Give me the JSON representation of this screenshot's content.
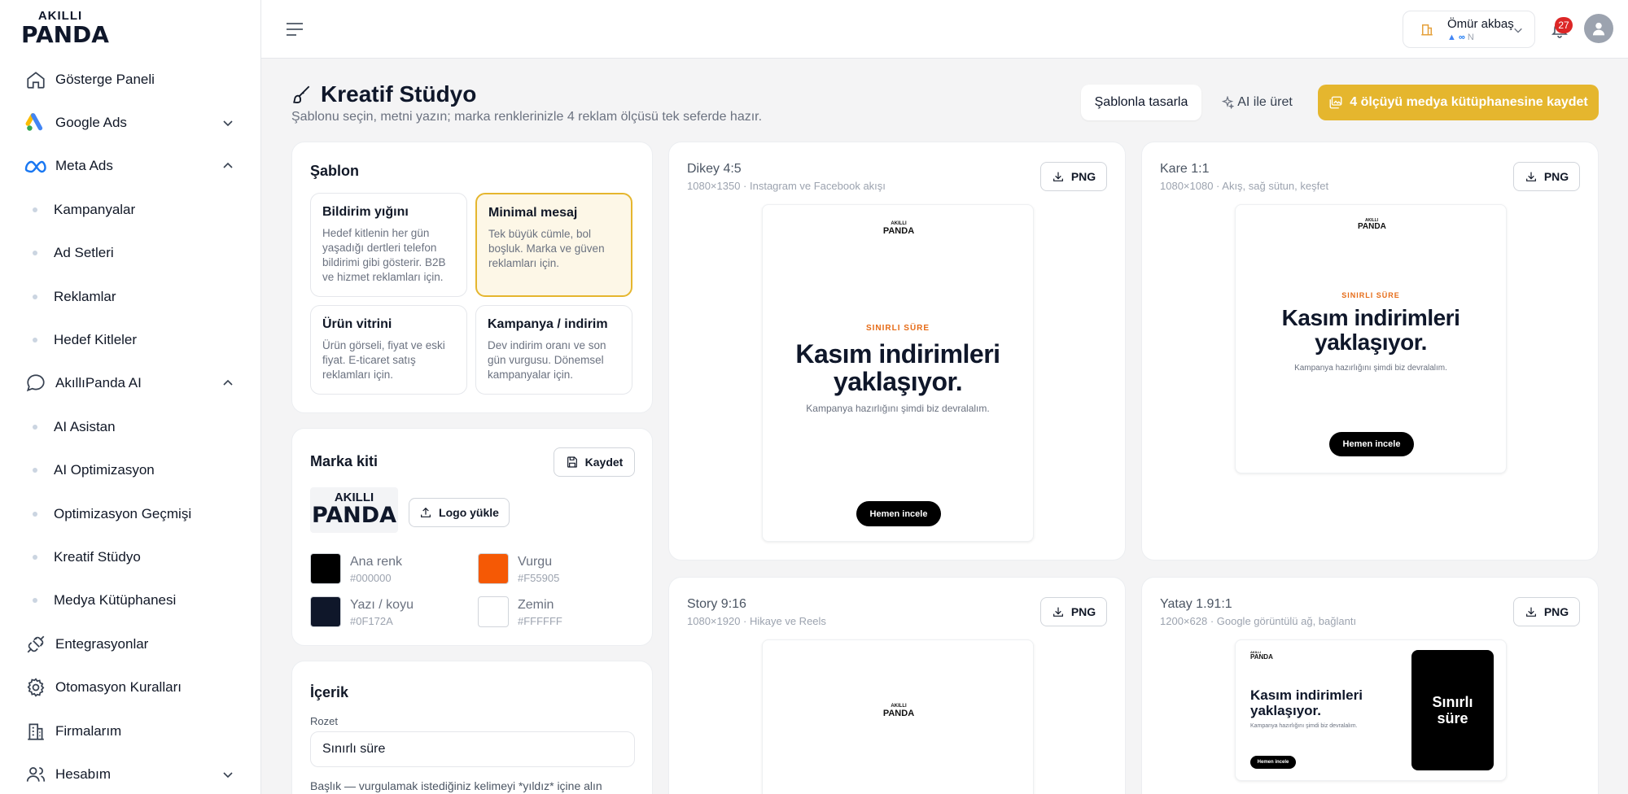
{
  "brand": {
    "logo_top": "AKILLI",
    "logo_bottom": "PANDA"
  },
  "sidebar": {
    "items": [
      {
        "label": "Gösterge Paneli"
      },
      {
        "label": "Google Ads"
      },
      {
        "label": "Meta Ads"
      },
      {
        "label": "Kampanyalar"
      },
      {
        "label": "Ad Setleri"
      },
      {
        "label": "Reklamlar"
      },
      {
        "label": "Hedef Kitleler"
      },
      {
        "label": "AkıllıPanda AI"
      },
      {
        "label": "AI Asistan"
      },
      {
        "label": "AI Optimizasyon"
      },
      {
        "label": "Optimizasyon Geçmişi"
      },
      {
        "label": "Kreatif Stüdyo"
      },
      {
        "label": "Medya Kütüphanesi"
      },
      {
        "label": "Entegrasyonlar"
      },
      {
        "label": "Otomasyon Kuralları"
      },
      {
        "label": "Firmalarım"
      },
      {
        "label": "Hesabım"
      }
    ]
  },
  "topbar": {
    "account_name": "Ömür akbaş",
    "account_sub": "N",
    "notifications": "27"
  },
  "page": {
    "title": "Kreatif Stüdyo",
    "subtitle": "Şablonu seçin, metni yazın; marka renklerinizle 4 reklam ölçüsü tek seferde hazır.",
    "btn_template": "Şablonla tasarla",
    "btn_ai": "AI ile üret",
    "btn_save_all": "4 ölçüyü medya kütüphanesine kaydet"
  },
  "templates": {
    "title": "Şablon",
    "items": [
      {
        "name": "Bildirim yığını",
        "desc": "Hedef kitlenin her gün yaşadığı dertleri telefon bildirimi gibi gösterir. B2B ve hizmet reklamları için."
      },
      {
        "name": "Minimal mesaj",
        "desc": "Tek büyük cümle, bol boşluk. Marka ve güven reklamları için."
      },
      {
        "name": "Ürün vitrini",
        "desc": "Ürün görseli, fiyat ve eski fiyat. E-ticaret satış reklamları için."
      },
      {
        "name": "Kampanya / indirim",
        "desc": "Dev indirim oranı ve son gün vurgusu. Dönemsel kampanyalar için."
      }
    ]
  },
  "brandkit": {
    "title": "Marka kiti",
    "save": "Kaydet",
    "upload": "Logo yükle",
    "colors": [
      {
        "name": "Ana renk",
        "hex": "#000000"
      },
      {
        "name": "Vurgu",
        "hex": "#F55905"
      },
      {
        "name": "Yazı / koyu",
        "hex": "#0F172A"
      },
      {
        "name": "Zemin",
        "hex": "#FFFFFF"
      }
    ]
  },
  "content": {
    "title": "İçerik",
    "badge_label": "Rozet",
    "badge_value": "Sınırlı süre",
    "headline_label": "Başlık — vurgulamak istediğiniz kelimeyi *yıldız* içine alın"
  },
  "ad": {
    "eyebrow": "SINIRLI SÜRE",
    "headline_1": "Kasım indirimleri",
    "headline_2": "yaklaşıyor.",
    "subline": "Kampanya hazırlığını şimdi biz devralalım.",
    "cta": "Hemen incele",
    "side_text_1": "Sınırlı",
    "side_text_2": "süre"
  },
  "previews": [
    {
      "title": "Dikey 4:5",
      "sub": "1080×1350 · Instagram ve Facebook akışı",
      "btn": "PNG"
    },
    {
      "title": "Kare 1:1",
      "sub": "1080×1080 · Akış, sağ sütun, keşfet",
      "btn": "PNG"
    },
    {
      "title": "Story 9:16",
      "sub": "1080×1920 · Hikaye ve Reels",
      "btn": "PNG"
    },
    {
      "title": "Yatay 1.91:1",
      "sub": "1200×628 · Google görüntülü ağ, bağlantı",
      "btn": "PNG"
    }
  ]
}
